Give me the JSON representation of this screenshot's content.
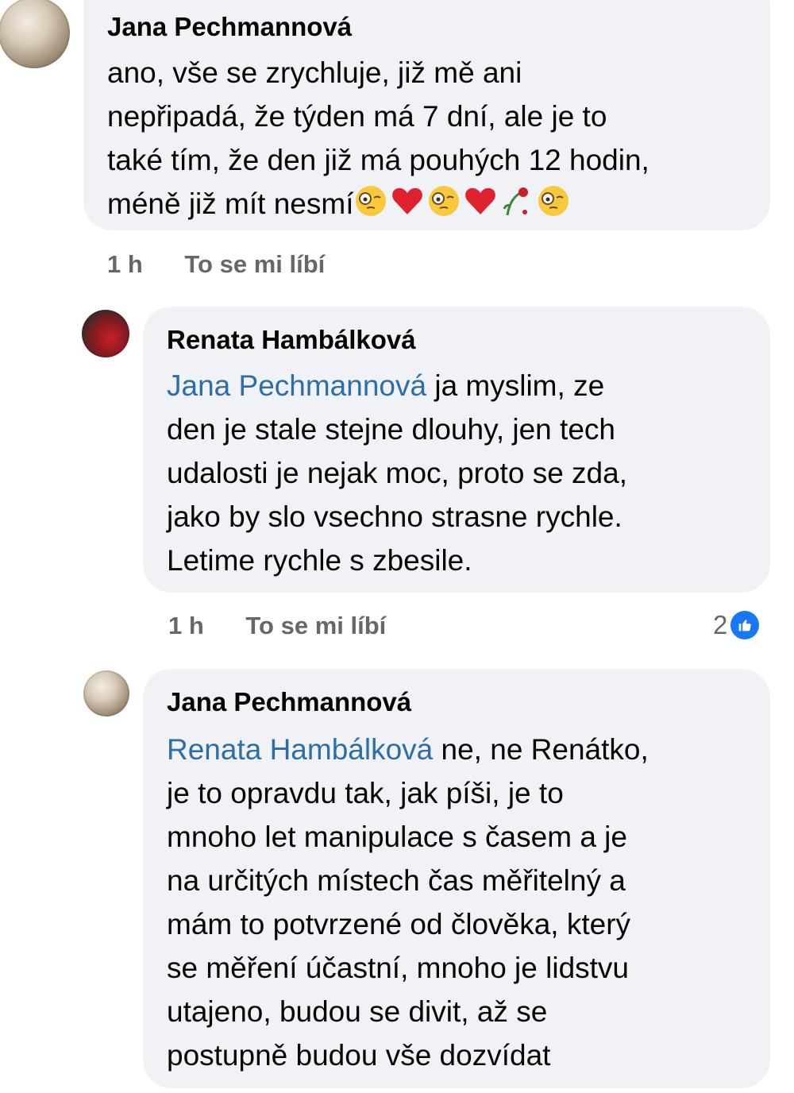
{
  "comments": [
    {
      "author": "Jana Pechmannová",
      "mention": "",
      "text_lines": [
        "ano, vše se zrychluje, již mě ani",
        "nepřipadá, že týden má 7 dní, ale je to",
        "také tím, že den již má pouhých 12 hodin,",
        "méně již mít nesmí"
      ],
      "emojis": [
        "monocle-face-emoji",
        "red-heart-emoji",
        "monocle-face-emoji",
        "red-heart-emoji",
        "wilted-rose-emoji",
        "monocle-face-emoji"
      ],
      "time": "1 h",
      "like_label": "To se mi líbí"
    },
    {
      "author": "Renata Hambálková",
      "mention": "Jana Pechmannová",
      "text_lines": [
        " ja myslim, ze",
        "den je stale stejne dlouhy, jen tech",
        "udalosti je nejak moc, proto se zda,",
        "jako by slo vsechno strasne rychle.",
        "Letime rychle s zbesile."
      ],
      "time": "1 h",
      "like_label": "To se mi líbí",
      "reaction_count": "2",
      "reaction_icon": "like-thumb-icon",
      "reaction_color": "#1877f2"
    },
    {
      "author": "Jana Pechmannová",
      "mention": "Renata Hambálková",
      "text_lines": [
        " ne, ne Renátko,",
        "je to opravdu tak, jak píši, je to",
        "mnoho let manipulace s časem a je",
        "na určitých místech čas měřitelný a",
        "mám to potvrzené od člověka, který",
        "se měření účastní, mnoho je lidstvu",
        "utajeno, budou se divit, až se",
        "postupně budou vše dozvídat"
      ]
    }
  ],
  "colors": {
    "bubble": "#f0f2f5",
    "mention": "#2d6ea8",
    "meta": "#65676b"
  }
}
